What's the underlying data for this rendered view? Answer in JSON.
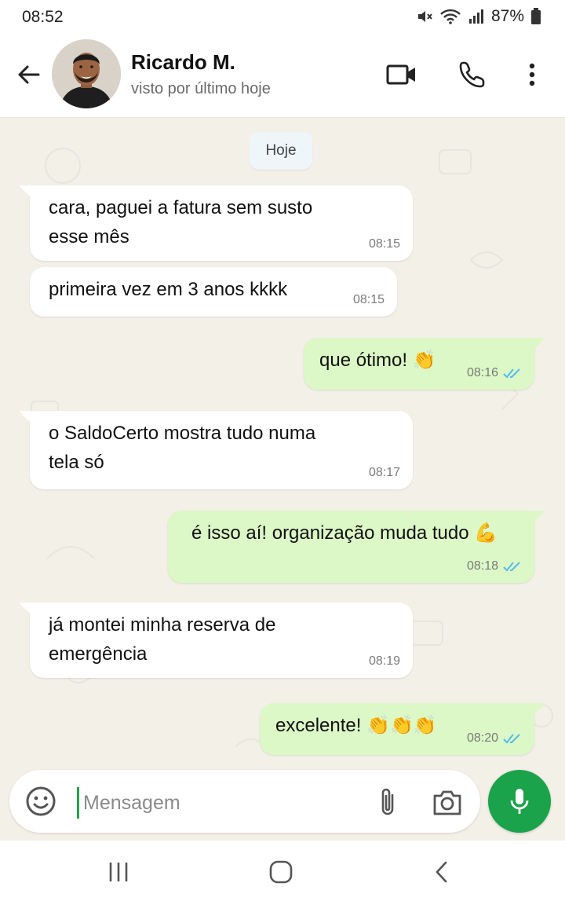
{
  "status_bar": {
    "time": "08:52",
    "battery": "87%",
    "icons": [
      "mute-icon",
      "wifi-icon",
      "signal-icon",
      "battery-icon"
    ]
  },
  "header": {
    "contact_name": "Ricardo M.",
    "last_seen": "visto por último hoje",
    "icons": [
      "back-arrow-icon",
      "video-call-icon",
      "phone-call-icon",
      "more-vert-icon"
    ]
  },
  "chat": {
    "date_label": "Hoje",
    "messages": [
      {
        "direction": "in",
        "lines": [
          "cara, paguei a fatura sem susto",
          "esse mês"
        ],
        "time": "08:15"
      },
      {
        "direction": "in",
        "lines": [
          "primeira vez em 3 anos kkkk"
        ],
        "time": "08:15"
      },
      {
        "direction": "out",
        "lines": [
          "que ótimo!"
        ],
        "emoji": "👏",
        "time": "08:16",
        "status": "read"
      },
      {
        "direction": "in",
        "lines": [
          "o SaldoCerto mostra tudo numa",
          "tela só"
        ],
        "time": "08:17"
      },
      {
        "direction": "out",
        "lines": [
          "é isso aí! organização muda tudo"
        ],
        "emoji": "💪",
        "time": "08:18",
        "status": "read"
      },
      {
        "direction": "in",
        "lines": [
          "já montei minha reserva de",
          "emergência"
        ],
        "time": "08:19"
      },
      {
        "direction": "out",
        "lines": [
          "excelente!"
        ],
        "emoji": "👏👏👏",
        "time": "08:20",
        "status": "read"
      }
    ]
  },
  "input": {
    "placeholder": "Mensagem"
  },
  "colors": {
    "chat_background": "#f3f0e8",
    "outgoing_bubble": "#dcf8c6",
    "incoming_bubble": "#ffffff",
    "accent_green": "#1aa34a",
    "read_ticks": "#53bdeb"
  }
}
